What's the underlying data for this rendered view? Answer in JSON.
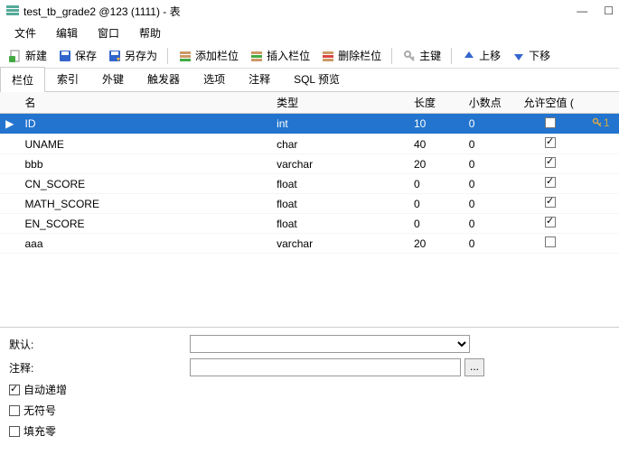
{
  "title": "test_tb_grade2 @123 (1111) - 表",
  "menu": {
    "file": "文件",
    "edit": "编辑",
    "window": "窗口",
    "help": "帮助"
  },
  "toolbar": {
    "new": "新建",
    "save": "保存",
    "saveas": "另存为",
    "addfield": "添加栏位",
    "insertfield": "插入栏位",
    "deletefield": "删除栏位",
    "primarykey": "主键",
    "moveup": "上移",
    "movedown": "下移"
  },
  "tabs": {
    "fields": "栏位",
    "indexes": "索引",
    "foreignkeys": "外键",
    "triggers": "触发器",
    "options": "选项",
    "comment": "注释",
    "sqlpreview": "SQL 预览"
  },
  "columns": {
    "name": "名",
    "type": "类型",
    "length": "长度",
    "decimals": "小数点",
    "allownull": "允许空值 ("
  },
  "rows": [
    {
      "name": "ID",
      "type": "int",
      "length": "10",
      "decimals": "0",
      "allownull": false,
      "pk": 1,
      "selected": true
    },
    {
      "name": "UNAME",
      "type": "char",
      "length": "40",
      "decimals": "0",
      "allownull": true
    },
    {
      "name": "bbb",
      "type": "varchar",
      "length": "20",
      "decimals": "0",
      "allownull": true
    },
    {
      "name": "CN_SCORE",
      "type": "float",
      "length": "0",
      "decimals": "0",
      "allownull": true
    },
    {
      "name": "MATH_SCORE",
      "type": "float",
      "length": "0",
      "decimals": "0",
      "allownull": true
    },
    {
      "name": "EN_SCORE",
      "type": "float",
      "length": "0",
      "decimals": "0",
      "allownull": true
    },
    {
      "name": "aaa",
      "type": "varchar",
      "length": "20",
      "decimals": "0",
      "allownull": false
    }
  ],
  "form": {
    "default_label": "默认:",
    "default_value": "",
    "comment_label": "注释:",
    "comment_value": "",
    "browse_btn": "...",
    "autoincrement_label": "自动递增",
    "autoincrement": true,
    "unsigned_label": "无符号",
    "unsigned": false,
    "zerofill_label": "填充零",
    "zerofill": false
  }
}
